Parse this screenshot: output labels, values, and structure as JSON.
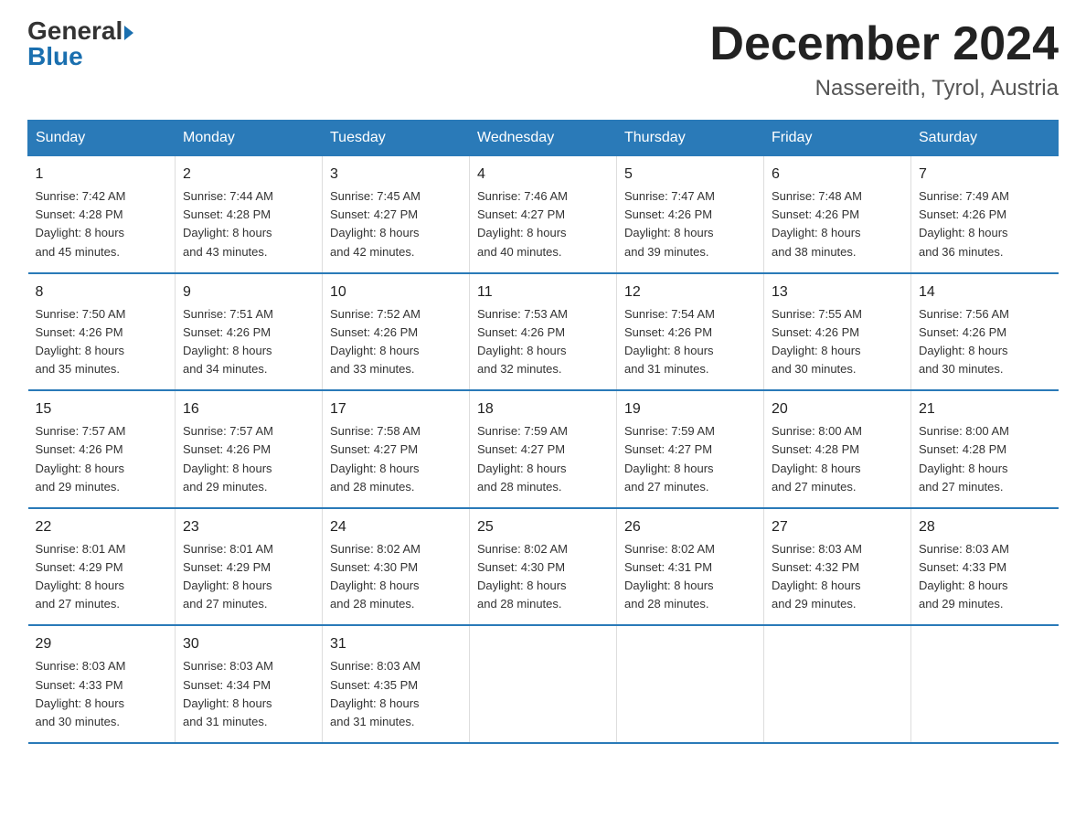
{
  "header": {
    "logo_line1": "General",
    "logo_line2": "Blue",
    "title": "December 2024",
    "subtitle": "Nassereith, Tyrol, Austria"
  },
  "days_of_week": [
    "Sunday",
    "Monday",
    "Tuesday",
    "Wednesday",
    "Thursday",
    "Friday",
    "Saturday"
  ],
  "weeks": [
    [
      {
        "day": "1",
        "info": "Sunrise: 7:42 AM\nSunset: 4:28 PM\nDaylight: 8 hours\nand 45 minutes."
      },
      {
        "day": "2",
        "info": "Sunrise: 7:44 AM\nSunset: 4:28 PM\nDaylight: 8 hours\nand 43 minutes."
      },
      {
        "day": "3",
        "info": "Sunrise: 7:45 AM\nSunset: 4:27 PM\nDaylight: 8 hours\nand 42 minutes."
      },
      {
        "day": "4",
        "info": "Sunrise: 7:46 AM\nSunset: 4:27 PM\nDaylight: 8 hours\nand 40 minutes."
      },
      {
        "day": "5",
        "info": "Sunrise: 7:47 AM\nSunset: 4:26 PM\nDaylight: 8 hours\nand 39 minutes."
      },
      {
        "day": "6",
        "info": "Sunrise: 7:48 AM\nSunset: 4:26 PM\nDaylight: 8 hours\nand 38 minutes."
      },
      {
        "day": "7",
        "info": "Sunrise: 7:49 AM\nSunset: 4:26 PM\nDaylight: 8 hours\nand 36 minutes."
      }
    ],
    [
      {
        "day": "8",
        "info": "Sunrise: 7:50 AM\nSunset: 4:26 PM\nDaylight: 8 hours\nand 35 minutes."
      },
      {
        "day": "9",
        "info": "Sunrise: 7:51 AM\nSunset: 4:26 PM\nDaylight: 8 hours\nand 34 minutes."
      },
      {
        "day": "10",
        "info": "Sunrise: 7:52 AM\nSunset: 4:26 PM\nDaylight: 8 hours\nand 33 minutes."
      },
      {
        "day": "11",
        "info": "Sunrise: 7:53 AM\nSunset: 4:26 PM\nDaylight: 8 hours\nand 32 minutes."
      },
      {
        "day": "12",
        "info": "Sunrise: 7:54 AM\nSunset: 4:26 PM\nDaylight: 8 hours\nand 31 minutes."
      },
      {
        "day": "13",
        "info": "Sunrise: 7:55 AM\nSunset: 4:26 PM\nDaylight: 8 hours\nand 30 minutes."
      },
      {
        "day": "14",
        "info": "Sunrise: 7:56 AM\nSunset: 4:26 PM\nDaylight: 8 hours\nand 30 minutes."
      }
    ],
    [
      {
        "day": "15",
        "info": "Sunrise: 7:57 AM\nSunset: 4:26 PM\nDaylight: 8 hours\nand 29 minutes."
      },
      {
        "day": "16",
        "info": "Sunrise: 7:57 AM\nSunset: 4:26 PM\nDaylight: 8 hours\nand 29 minutes."
      },
      {
        "day": "17",
        "info": "Sunrise: 7:58 AM\nSunset: 4:27 PM\nDaylight: 8 hours\nand 28 minutes."
      },
      {
        "day": "18",
        "info": "Sunrise: 7:59 AM\nSunset: 4:27 PM\nDaylight: 8 hours\nand 28 minutes."
      },
      {
        "day": "19",
        "info": "Sunrise: 7:59 AM\nSunset: 4:27 PM\nDaylight: 8 hours\nand 27 minutes."
      },
      {
        "day": "20",
        "info": "Sunrise: 8:00 AM\nSunset: 4:28 PM\nDaylight: 8 hours\nand 27 minutes."
      },
      {
        "day": "21",
        "info": "Sunrise: 8:00 AM\nSunset: 4:28 PM\nDaylight: 8 hours\nand 27 minutes."
      }
    ],
    [
      {
        "day": "22",
        "info": "Sunrise: 8:01 AM\nSunset: 4:29 PM\nDaylight: 8 hours\nand 27 minutes."
      },
      {
        "day": "23",
        "info": "Sunrise: 8:01 AM\nSunset: 4:29 PM\nDaylight: 8 hours\nand 27 minutes."
      },
      {
        "day": "24",
        "info": "Sunrise: 8:02 AM\nSunset: 4:30 PM\nDaylight: 8 hours\nand 28 minutes."
      },
      {
        "day": "25",
        "info": "Sunrise: 8:02 AM\nSunset: 4:30 PM\nDaylight: 8 hours\nand 28 minutes."
      },
      {
        "day": "26",
        "info": "Sunrise: 8:02 AM\nSunset: 4:31 PM\nDaylight: 8 hours\nand 28 minutes."
      },
      {
        "day": "27",
        "info": "Sunrise: 8:03 AM\nSunset: 4:32 PM\nDaylight: 8 hours\nand 29 minutes."
      },
      {
        "day": "28",
        "info": "Sunrise: 8:03 AM\nSunset: 4:33 PM\nDaylight: 8 hours\nand 29 minutes."
      }
    ],
    [
      {
        "day": "29",
        "info": "Sunrise: 8:03 AM\nSunset: 4:33 PM\nDaylight: 8 hours\nand 30 minutes."
      },
      {
        "day": "30",
        "info": "Sunrise: 8:03 AM\nSunset: 4:34 PM\nDaylight: 8 hours\nand 31 minutes."
      },
      {
        "day": "31",
        "info": "Sunrise: 8:03 AM\nSunset: 4:35 PM\nDaylight: 8 hours\nand 31 minutes."
      },
      {
        "day": "",
        "info": ""
      },
      {
        "day": "",
        "info": ""
      },
      {
        "day": "",
        "info": ""
      },
      {
        "day": "",
        "info": ""
      }
    ]
  ]
}
